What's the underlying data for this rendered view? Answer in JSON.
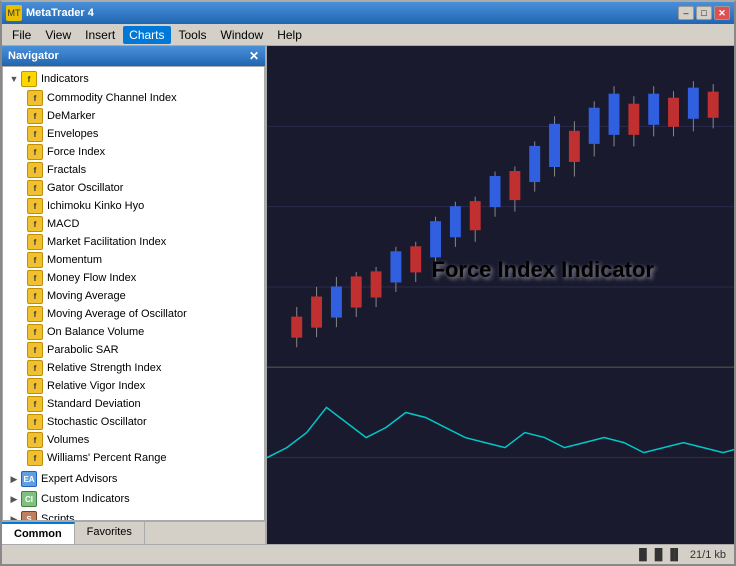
{
  "window": {
    "title": "MetaTrader 4",
    "icon": "MT"
  },
  "title_buttons": {
    "minimize": "–",
    "maximize": "□",
    "close": "✕"
  },
  "menu": {
    "items": [
      {
        "id": "file",
        "label": "File"
      },
      {
        "id": "view",
        "label": "View"
      },
      {
        "id": "insert",
        "label": "Insert"
      },
      {
        "id": "charts",
        "label": "Charts"
      },
      {
        "id": "tools",
        "label": "Tools"
      },
      {
        "id": "window",
        "label": "Window"
      },
      {
        "id": "help",
        "label": "Help"
      }
    ],
    "active": "Charts"
  },
  "navigator": {
    "title": "Navigator",
    "sections": {
      "indicators": {
        "label": "Indicators",
        "items": [
          "Commodity Channel Index",
          "DeMarker",
          "Envelopes",
          "Force Index",
          "Fractals",
          "Gator Oscillator",
          "Ichimoku Kinko Hyo",
          "MACD",
          "Market Facilitation Index",
          "Momentum",
          "Money Flow Index",
          "Moving Average",
          "Moving Average of Oscillator",
          "On Balance Volume",
          "Parabolic SAR",
          "Relative Strength Index",
          "Relative Vigor Index",
          "Standard Deviation",
          "Stochastic Oscillator",
          "Volumes",
          "Williams' Percent Range"
        ]
      },
      "expert_advisors": {
        "label": "Expert Advisors"
      },
      "custom_indicators": {
        "label": "Custom Indicators"
      },
      "scripts": {
        "label": "Scripts"
      }
    }
  },
  "navigator_tabs": [
    {
      "id": "common",
      "label": "Common",
      "active": true
    },
    {
      "id": "favorites",
      "label": "Favorites",
      "active": false
    }
  ],
  "chart": {
    "title": "Force Index Indicator",
    "background": "#1a1a2e"
  },
  "status_bar": {
    "chart_icon": "▐▌▐▌▐▌",
    "info": "21/1 kb"
  }
}
